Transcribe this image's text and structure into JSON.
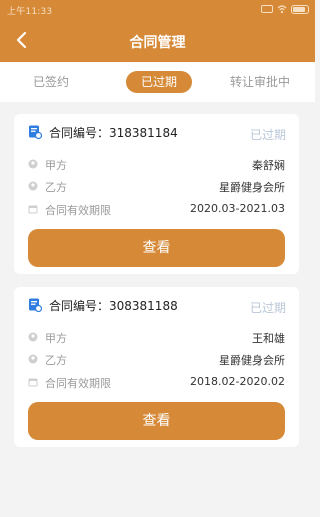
{
  "status_bar": {
    "time": "上午11:33"
  },
  "header": {
    "title": "合同管理"
  },
  "tabs": [
    {
      "label": "已签约",
      "active": false
    },
    {
      "label": "已过期",
      "active": true
    },
    {
      "label": "转让审批中",
      "active": false
    }
  ],
  "labels": {
    "party_a": "甲方",
    "party_b": "乙方",
    "validity": "合同有效期限",
    "view": "查看"
  },
  "contracts": [
    {
      "number": "合同编号：318381184",
      "status": "已过期",
      "party_a": "秦舒娴",
      "party_b": "星爵健身会所",
      "period": "2020.03-2021.03"
    },
    {
      "number": "合同编号：308381188",
      "status": "已过期",
      "party_a": "王和雄",
      "party_b": "星爵健身会所",
      "period": "2018.02-2020.02"
    }
  ],
  "colors": {
    "accent": "#d68a37",
    "status_text": "#b9c6d7",
    "icon_blue": "#2f7de1"
  }
}
